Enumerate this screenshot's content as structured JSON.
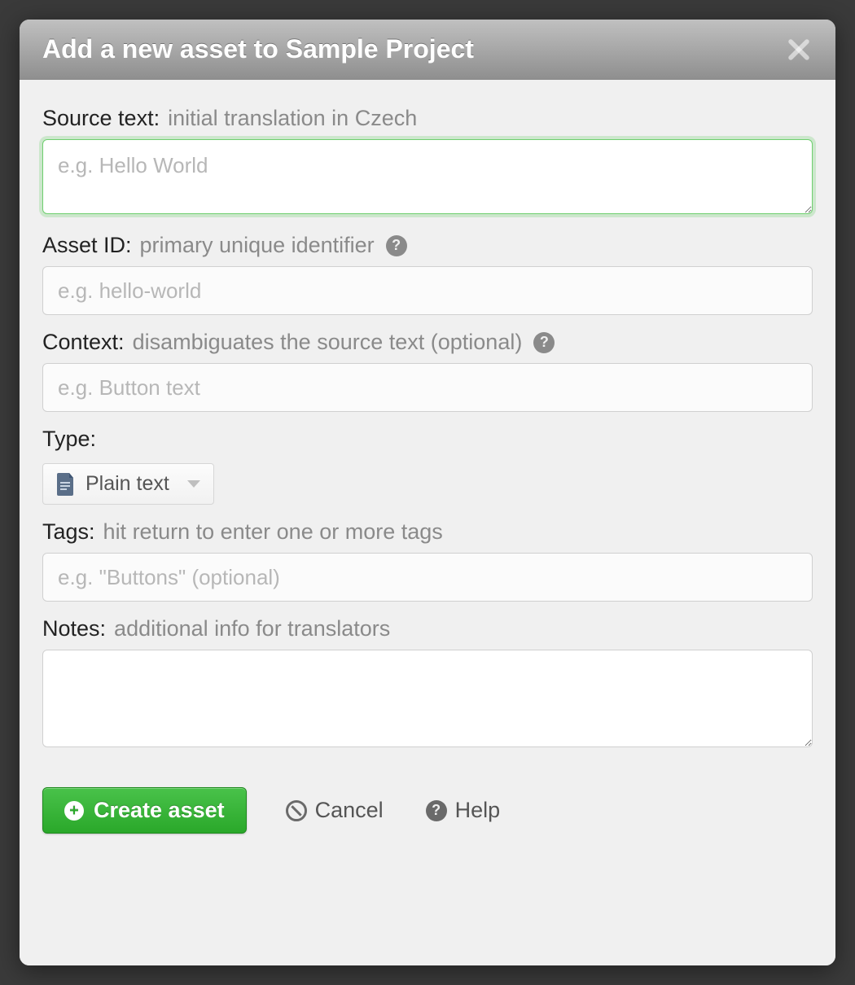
{
  "modal": {
    "title": "Add a new asset to Sample Project"
  },
  "fields": {
    "source_text": {
      "label": "Source text:",
      "hint": "initial translation in Czech",
      "placeholder": "e.g. Hello World"
    },
    "asset_id": {
      "label": "Asset ID:",
      "hint": "primary unique identifier",
      "placeholder": "e.g. hello-world"
    },
    "context": {
      "label": "Context:",
      "hint": "disambiguates the source text (optional)",
      "placeholder": "e.g. Button text"
    },
    "type": {
      "label": "Type:",
      "selected": "Plain text"
    },
    "tags": {
      "label": "Tags:",
      "hint": "hit return to enter one or more tags",
      "placeholder": "e.g. \"Buttons\" (optional)"
    },
    "notes": {
      "label": "Notes:",
      "hint": "additional info for translators",
      "placeholder": ""
    }
  },
  "footer": {
    "create": "Create asset",
    "cancel": "Cancel",
    "help": "Help"
  }
}
